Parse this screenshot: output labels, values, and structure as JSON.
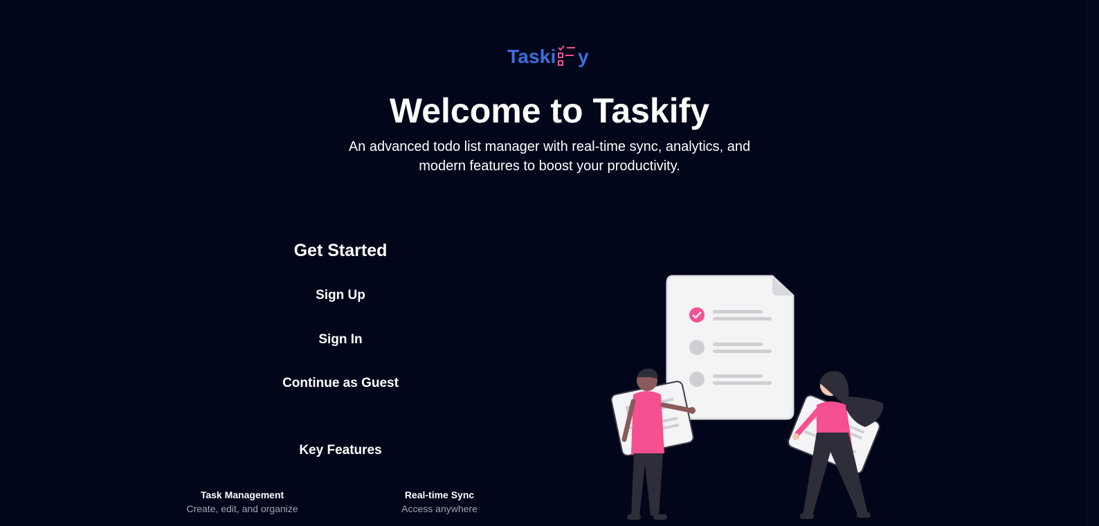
{
  "logo": {
    "text_before": "Taski",
    "text_after": "y",
    "mark_icon": "checklist-icon"
  },
  "hero": {
    "title": "Welcome to Taskify",
    "subtitle_line1": "An advanced todo list manager with real-time sync, analytics, and",
    "subtitle_line2": "modern features to boost your productivity."
  },
  "get_started": {
    "heading": "Get Started",
    "sign_up": "Sign Up",
    "sign_in": "Sign In",
    "guest": "Continue as Guest"
  },
  "features": {
    "heading": "Key Features",
    "items": [
      {
        "title": "Task Management",
        "desc": "Create, edit, and organize"
      },
      {
        "title": "Real-time Sync",
        "desc": "Access anywhere"
      }
    ]
  },
  "colors": {
    "background": "#02061a",
    "brand_blue": "#3b6fe0",
    "accent_pink": "#f5508f",
    "muted_text": "#a0a4b3"
  },
  "illustration": {
    "icon": "people-with-checklist-illustration"
  }
}
